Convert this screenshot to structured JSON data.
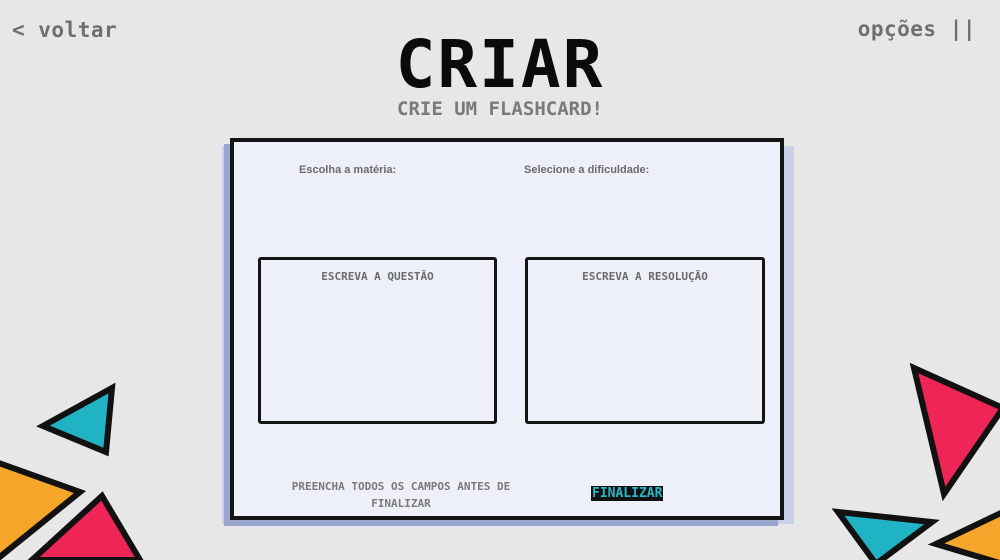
{
  "nav": {
    "back_label": "< voltar",
    "options_label": "opções ||"
  },
  "header": {
    "title": "CRIAR",
    "subtitle": "CRIE UM FLASHCARD!"
  },
  "form": {
    "subject_label": "Escolha a matéria:",
    "difficulty_label": "Selecione a dificuldade:",
    "question_label": "ESCREVA A QUESTÃO",
    "answer_label": "ESCREVA A RESOLUÇÃO",
    "note": "PREENCHA TODOS OS CAMPOS ANTES DE FINALIZAR",
    "finalize_label": "FINALIZAR"
  },
  "colors": {
    "background": "#e7e7e7",
    "card": "#edf0f8",
    "teal": "#1fb3c4",
    "pink": "#ef2556",
    "orange": "#f4a52a"
  }
}
